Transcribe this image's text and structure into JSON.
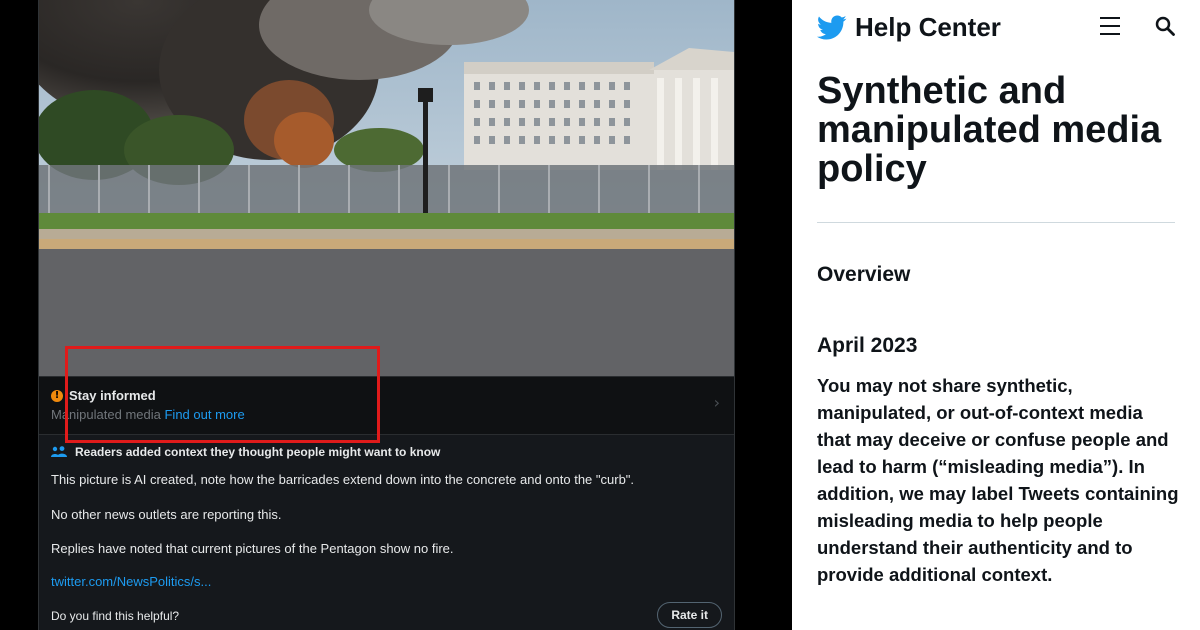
{
  "tweet": {
    "warning": {
      "title": "Stay informed",
      "subtitle": "Manipulated media",
      "link": "Find out more",
      "icon": "alert-circle-icon",
      "accent_color": "#f08a0d"
    },
    "notes": {
      "header": "Readers added context they thought people might want to know",
      "lines": [
        "This picture is AI created, note how the barricades extend down into the concrete and onto the \"curb\".",
        "No other news outlets are reporting this.",
        "Replies have noted that current pictures of the Pentagon show no fire."
      ],
      "link": "twitter.com/NewsPolitics/s...",
      "helpful_question": "Do you find this helpful?",
      "rate_button": "Rate it"
    },
    "highlight_color": "#e01b1b",
    "link_color": "#1d9bf0"
  },
  "help_center": {
    "brand": "Help Center",
    "title": "Synthetic and manipulated media policy",
    "section": "Overview",
    "date": "April 2023",
    "body": "You may not share synthetic, manipulated, or out-of-context media that may deceive or confuse people and lead to harm (“misleading media”). In addition, we may label Tweets containing misleading media to help people understand their authenticity and to provide additional context.",
    "brand_color": "#1d9bf0"
  }
}
